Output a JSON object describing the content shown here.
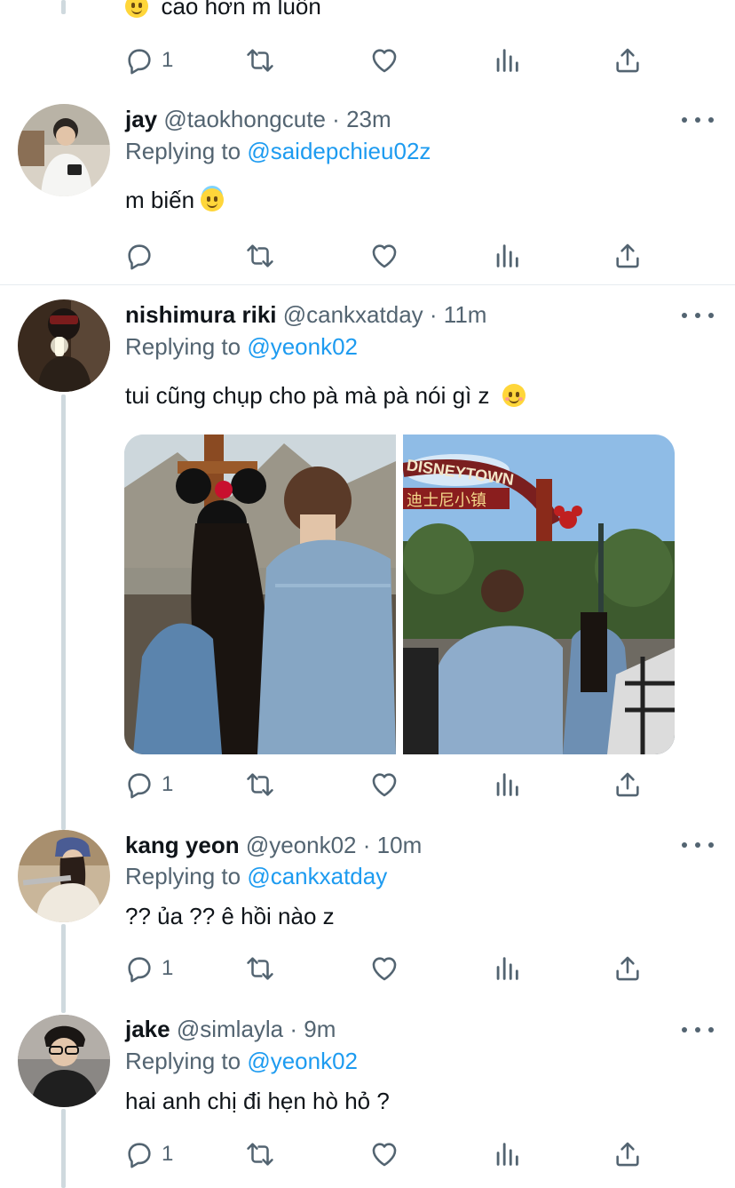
{
  "top_partial": {
    "text": "cao hơn m luôn",
    "reply_count": "1"
  },
  "tweets": [
    {
      "name": "jay",
      "handle": "@taokhongcute",
      "sep": "·",
      "time": "23m",
      "replying_label": "Replying to",
      "replying_to": "@saidepchieu02z",
      "text": "m biến",
      "reply_count": ""
    },
    {
      "name": "nishimura riki",
      "handle": "@cankxatday",
      "sep": "·",
      "time": "11m",
      "replying_label": "Replying to",
      "replying_to": "@yeonk02",
      "text": "tui cũng chụp cho pà mà pà nói gì z",
      "reply_count": "1"
    },
    {
      "name": "kang yeon",
      "handle": "@yeonk02",
      "sep": "·",
      "time": "10m",
      "replying_label": "Replying to",
      "replying_to": "@cankxatday",
      "text": "?? ủa ?? ê hồi nào z",
      "reply_count": "1"
    },
    {
      "name": "jake",
      "handle": "@simlayla",
      "sep": "·",
      "time": "9m",
      "replying_label": "Replying to",
      "replying_to": "@yeonk02",
      "text": "hai anh chị đi hẹn hò hỏ ?",
      "reply_count": "1"
    }
  ],
  "photo_sign": {
    "arch_text": "DISNEYTOWN",
    "chinese_text": "迪士尼小镇"
  },
  "icons": [
    "reply-icon",
    "retweet-icon",
    "like-icon",
    "views-icon",
    "share-icon",
    "more-icon"
  ],
  "colors": {
    "link": "#1d9bf0",
    "secondary": "#536471",
    "text": "#0f1419",
    "thread_line": "#cfd9de"
  }
}
